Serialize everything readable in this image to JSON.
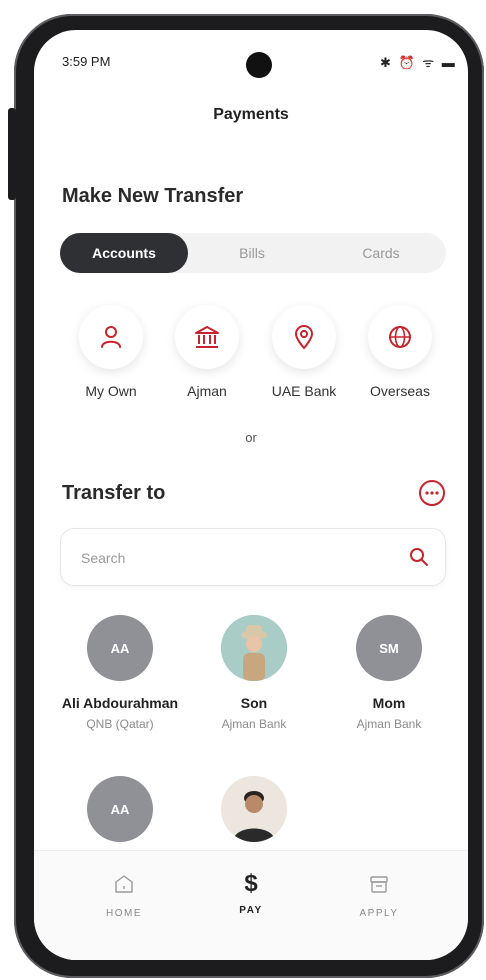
{
  "status": {
    "time": "3:59 PM",
    "icons": "✱ ⏰ ᯤ ▬"
  },
  "header": {
    "title": "Payments"
  },
  "transfer": {
    "title": "Make New Transfer",
    "tabs": [
      {
        "label": "Accounts",
        "active": true
      },
      {
        "label": "Bills"
      },
      {
        "label": "Cards"
      }
    ],
    "options": [
      {
        "label": "My Own",
        "icon": "person-icon"
      },
      {
        "label": "Ajman",
        "icon": "bank-icon"
      },
      {
        "label": "UAE Bank",
        "icon": "location-pin-icon"
      },
      {
        "label": "Overseas",
        "icon": "globe-icon"
      }
    ],
    "or": "or"
  },
  "transfer_to": {
    "title": "Transfer to",
    "search_placeholder": "Search",
    "contacts": [
      {
        "initials": "AA",
        "name": "Ali Abdourahman",
        "bank": "QNB (Qatar)"
      },
      {
        "initials": "",
        "name": "Son",
        "bank": "Ajman Bank"
      },
      {
        "initials": "SM",
        "name": "Mom",
        "bank": "Ajman Bank"
      },
      {
        "initials": "AA",
        "name": "",
        "bank": ""
      },
      {
        "initials": "",
        "name": "",
        "bank": ""
      }
    ]
  },
  "nav": {
    "items": [
      {
        "label": "HOME"
      },
      {
        "label": "PAY",
        "active": true
      },
      {
        "label": "APPLY"
      }
    ]
  },
  "colors": {
    "accent": "#c8232c",
    "dark": "#2f3033",
    "avatar_gray": "#8f9197"
  }
}
